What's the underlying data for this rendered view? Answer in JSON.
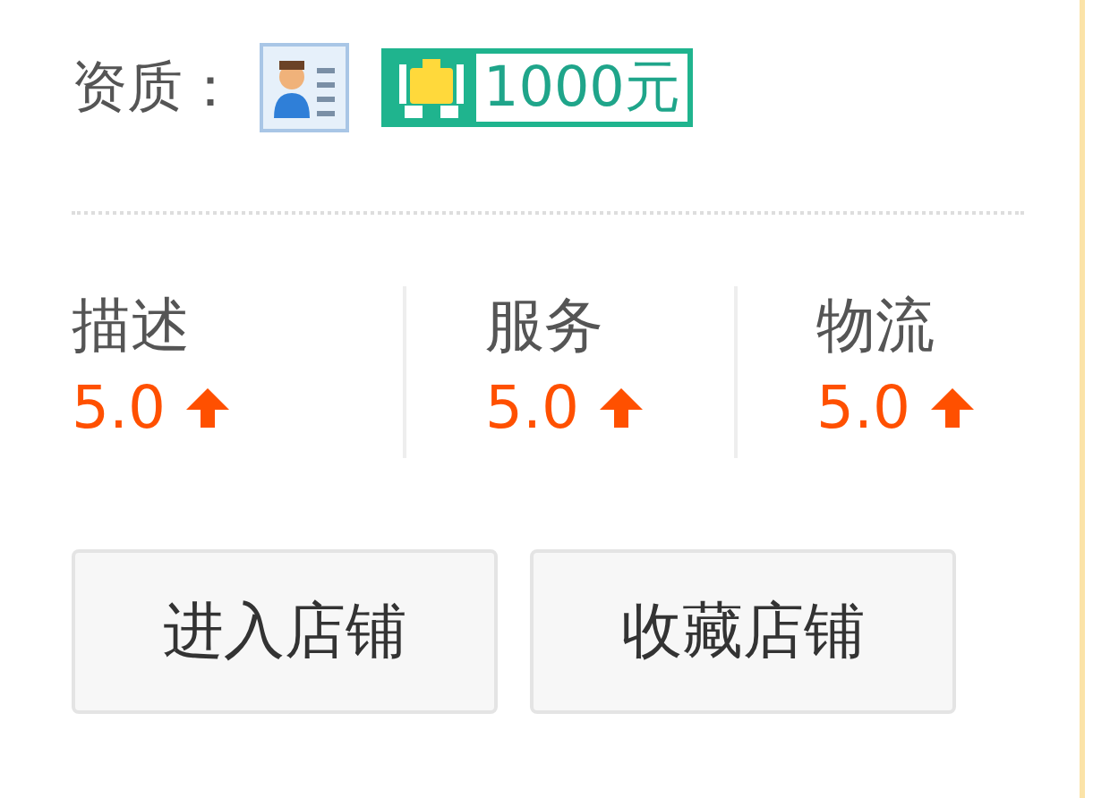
{
  "qualification": {
    "label": "资质：",
    "deposit": "1000元"
  },
  "ratings": [
    {
      "label": "描述",
      "score": "5.0",
      "kind": "up"
    },
    {
      "label": "服务",
      "score": "5.0",
      "kind": "up"
    },
    {
      "label": "物流",
      "score": "5.0",
      "kind": "up"
    }
  ],
  "buttons": [
    "进入店铺",
    "收藏店铺"
  ]
}
